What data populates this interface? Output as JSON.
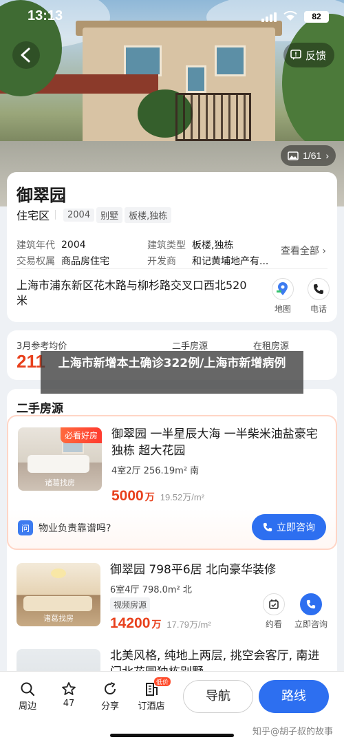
{
  "status_bar": {
    "time": "13:13",
    "battery": "82"
  },
  "header": {
    "feedback_label": "反馈",
    "photo_counter": "1/61"
  },
  "estate": {
    "name": "御翠园",
    "category": "住宅区",
    "tags": [
      "2004",
      "别墅",
      "板楼,独栋"
    ],
    "specs": [
      {
        "k1": "建筑年代",
        "v1": "2004",
        "k2": "建筑类型",
        "v2": "板楼,独栋"
      },
      {
        "k1": "交易权属",
        "v1": "商品房住宅",
        "k2": "开发商",
        "v2": "和记黄埔地产有..."
      }
    ],
    "see_all": "查看全部",
    "address": "上海市浦东新区花木路与柳杉路交叉口西北520米",
    "map_label": "地图",
    "phone_label": "电话"
  },
  "price_summary": {
    "ref_label": "3月参考均价",
    "ref_value": "211",
    "second_label": "二手房源",
    "rent_label": "在租房源"
  },
  "overlay_caption": "上海市新增本土确诊322例/上海市新增病例",
  "listings_section": {
    "title": "二手房源",
    "items": [
      {
        "badge": "必看好房",
        "watermark": "诸葛找房",
        "title": "御翠园 一半星辰大海 一半柴米油盐豪宅独栋 超大花园",
        "meta": "4室2厅  256.19m²  南",
        "price": "5000",
        "price_unit": "万",
        "unit_price": "19.52万/m²",
        "qa_icon": "问",
        "qa_text": "物业负责靠谱吗?",
        "consult_label": "立即咨询"
      },
      {
        "watermark": "诸葛找房",
        "title": "御翠园 798平6居 北向豪华装修",
        "meta": "6室4厅  798.0m²  北",
        "video_tag": "视频房源",
        "price": "14200",
        "price_unit": "万",
        "unit_price": "17.79万/m²",
        "book_label": "约看",
        "consult_label": "立即咨询"
      },
      {
        "title": "北美风格, 纯地上两层, 挑空会客厅, 南进门北花园独栋别墅"
      }
    ]
  },
  "bottom_bar": {
    "tabs": [
      "周边",
      "47",
      "分享",
      "订酒店"
    ],
    "hotel_badge": "低价",
    "nav_label": "导航",
    "route_label": "路线",
    "watermark": "知乎@胡子叔的故事"
  },
  "colors": {
    "accent_blue": "#2d6ff0",
    "price_red": "#e8401c"
  }
}
